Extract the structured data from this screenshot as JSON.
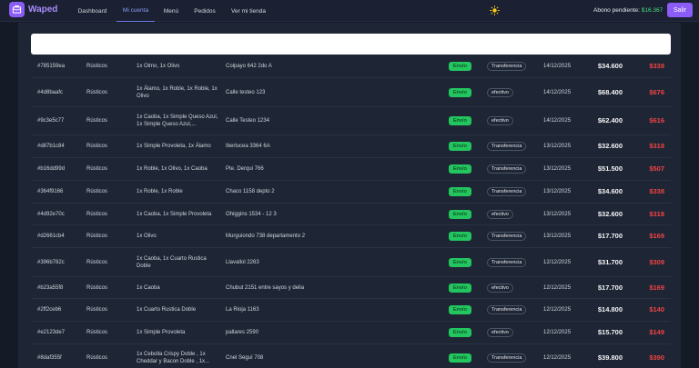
{
  "app": {
    "brand": "Waped",
    "nav": [
      {
        "label": "Dashboard",
        "active": false
      },
      {
        "label": "Mi cuenta",
        "active": true
      },
      {
        "label": "Menú",
        "active": false
      },
      {
        "label": "Pedidos",
        "active": false
      },
      {
        "label": "Ver mi tienda",
        "active": false
      }
    ],
    "theme_icon": "sun-icon",
    "abono_label": "Abono pendiente:",
    "abono_amount": "$16.367",
    "logout_label": "Salir",
    "colors": {
      "accent": "#8b5cf6",
      "success": "#22c55e",
      "danger": "#ef4444",
      "positive_amount": "#4ade80"
    }
  },
  "orders": [
    {
      "id": "#785159ea",
      "category": "Rústicos",
      "items": "1x Olmo, 1x Olivo",
      "address": "Colpayo 642 2do A",
      "shipping": "Envío",
      "payment": "Transferencia",
      "date": "14/12/2025",
      "total": "$34.600",
      "fee": "$338"
    },
    {
      "id": "#4d8baafc",
      "category": "Rústicos",
      "items": "1x Álamo, 1x Roble, 1x Roble, 1x Olivo",
      "address": "Calle testeo 123",
      "shipping": "Envío",
      "payment": "efectivo",
      "date": "14/12/2025",
      "total": "$68.400",
      "fee": "$676"
    },
    {
      "id": "#9c3e5c77",
      "category": "Rústicos",
      "items": "1x Caoba, 1x Simple Queso Azul, 1x Simple Queso Azul,...",
      "address": "Calle Testeo 1234",
      "shipping": "Envío",
      "payment": "efectivo",
      "date": "14/12/2025",
      "total": "$62.400",
      "fee": "$616"
    },
    {
      "id": "#d87b1c84",
      "category": "Rústicos",
      "items": "1x Simple Provoleta, 1x Álamo",
      "address": "Iberlucea 3364 6A",
      "shipping": "Envío",
      "payment": "Transferencia",
      "date": "13/12/2025",
      "total": "$32.600",
      "fee": "$318"
    },
    {
      "id": "#b16dd99d",
      "category": "Rústicos",
      "items": "1x Roble, 1x Olivo, 1x Caoba",
      "address": "Pte. Derqui 766",
      "shipping": "Envío",
      "payment": "Transferencia",
      "date": "13/12/2025",
      "total": "$51.500",
      "fee": "$507"
    },
    {
      "id": "#364f9166",
      "category": "Rústicos",
      "items": "1x Roble, 1x Roble",
      "address": "Chaco 1158 depto 2",
      "shipping": "Envío",
      "payment": "Transferencia",
      "date": "13/12/2025",
      "total": "$34.600",
      "fee": "$338"
    },
    {
      "id": "#4d92e70c",
      "category": "Rústicos",
      "items": "1x Caoba, 1x Simple Provoleta",
      "address": "Ohiggins 1534 - 12 3",
      "shipping": "Envío",
      "payment": "efectivo",
      "date": "13/12/2025",
      "total": "$32.600",
      "fee": "$318"
    },
    {
      "id": "#d2661cb4",
      "category": "Rústicos",
      "items": "1x Olivo",
      "address": "Murguiondo 738 departamento 2",
      "shipping": "Envío",
      "payment": "Transferencia",
      "date": "13/12/2025",
      "total": "$17.700",
      "fee": "$169"
    },
    {
      "id": "#396b782c",
      "category": "Rústicos",
      "items": "1x Caoba, 1x Cuarto Rustica Doble",
      "address": "Llavallol 2263",
      "shipping": "Envío",
      "payment": "Transferencia",
      "date": "12/12/2025",
      "total": "$31.700",
      "fee": "$309"
    },
    {
      "id": "#b23a55f8",
      "category": "Rústicos",
      "items": "1x Caoba",
      "address": "Chubut 2151 entre sayos y delia",
      "shipping": "Envío",
      "payment": "efectivo",
      "date": "12/12/2025",
      "total": "$17.700",
      "fee": "$169"
    },
    {
      "id": "#2ff2ceb6",
      "category": "Rústicos",
      "items": "1x Cuarto Rustica Doble",
      "address": "La Rioja 1163",
      "shipping": "Envío",
      "payment": "Transferencia",
      "date": "12/12/2025",
      "total": "$14.800",
      "fee": "$140"
    },
    {
      "id": "#e2123de7",
      "category": "Rústicos",
      "items": "1x Simple Provoleta",
      "address": "pallares 2590",
      "shipping": "Envío",
      "payment": "efectivo",
      "date": "12/12/2025",
      "total": "$15.700",
      "fee": "$149"
    },
    {
      "id": "#8daf355f",
      "category": "Rústicos",
      "items": "1x Cebolla Crispy Doble , 1x Cheddar y Bacon Doble , 1x...",
      "address": "Cnel Seguí 708",
      "shipping": "Envío",
      "payment": "Transferencia",
      "date": "12/12/2025",
      "total": "$39.800",
      "fee": "$390"
    }
  ]
}
